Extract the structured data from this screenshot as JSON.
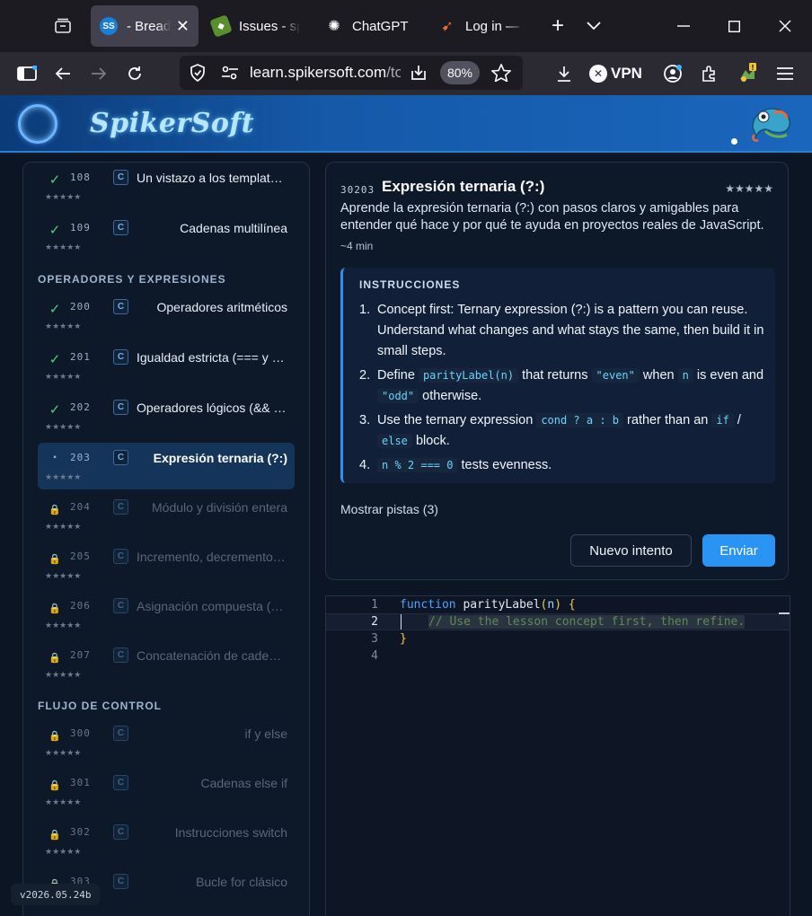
{
  "browser": {
    "tabs": [
      {
        "label": "- Breadt",
        "active": true
      },
      {
        "label": "Issues - spi",
        "active": false
      },
      {
        "label": "ChatGPT",
        "active": false
      },
      {
        "label": "Log in — S",
        "active": false
      }
    ],
    "url_host": "learn.spikersoft.com",
    "url_rest": "/to",
    "zoom": "80%",
    "vpn_label": "VPN",
    "icons": [
      "tab-list-icon",
      "new-tab-icon",
      "chevron-down-icon",
      "minimize-icon",
      "maximize-icon",
      "close-icon",
      "sidebar-icon",
      "back-icon",
      "forward-icon",
      "reload-icon",
      "shield-icon",
      "permissions-icon",
      "save-page-icon",
      "bookmark-star-icon",
      "download-icon",
      "vpn-icon",
      "account-icon",
      "extensions-icon",
      "notice-icon",
      "menu-icon"
    ]
  },
  "site": {
    "brand": "SpikerSoft"
  },
  "sidebar": {
    "sections": [
      "OPERADORES Y EXPRESIONES",
      "FLUJO DE CONTROL"
    ],
    "lessons": [
      {
        "num": "108",
        "title": "Un vistazo a los templates literales",
        "status": "done",
        "stars": "★★★★★"
      },
      {
        "num": "109",
        "title": "Cadenas multilínea",
        "status": "done",
        "stars": "★★★★★"
      },
      {
        "num": "200",
        "title": "Operadores aritméticos",
        "status": "done",
        "stars": "★★★★★"
      },
      {
        "num": "201",
        "title": "Igualdad estricta (=== y !==)",
        "status": "done",
        "stars": "★★★★★"
      },
      {
        "num": "202",
        "title": "Operadores lógicos (&& || !)",
        "status": "done",
        "stars": "★★★★★"
      },
      {
        "num": "203",
        "title": "Expresión ternaria (?:)",
        "status": "current",
        "stars": "★★★★★"
      },
      {
        "num": "204",
        "title": "Módulo y división entera",
        "status": "locked",
        "stars": "★★★★★"
      },
      {
        "num": "205",
        "title": "Incremento, decremento y más",
        "status": "locked",
        "stars": "★★★★★"
      },
      {
        "num": "206",
        "title": "Asignación compuesta (+=, -=)",
        "status": "locked",
        "stars": "★★★★★"
      },
      {
        "num": "207",
        "title": "Concatenación de cadenas",
        "status": "locked",
        "stars": "★★★★★"
      },
      {
        "num": "300",
        "title": "if y else",
        "status": "locked",
        "stars": "★★★★★"
      },
      {
        "num": "301",
        "title": "Cadenas else if",
        "status": "locked",
        "stars": "★★★★★"
      },
      {
        "num": "302",
        "title": "Instrucciones switch",
        "status": "locked",
        "stars": "★★★★★"
      },
      {
        "num": "303",
        "title": "Bucle for clásico",
        "status": "locked",
        "stars": "★★★★★"
      }
    ],
    "badge": "C",
    "version": "v2026.05.24b"
  },
  "lesson": {
    "id": "30203",
    "title": "Expresión ternaria (?:)",
    "stars": "★★★★★",
    "description": "Aprende la expresión ternaria (?:) con pasos claros y amigables para entender qué hace y por qué te ayuda en proyectos reales de JavaScript.",
    "time": "~4 min",
    "instructions_heading": "INSTRUCCIONES",
    "steps": {
      "s1": {
        "n": "1.",
        "text": "Concept first: Ternary expression (?:) is a pattern you can reuse. Understand what changes and what stays the same, then build it in small steps."
      },
      "s2": {
        "n": "2.",
        "a": "Define",
        "c1": "parityLabel(n)",
        "b": "that returns",
        "c2": "\"even\"",
        "d": "when",
        "c3": "n",
        "e": "is even and",
        "c4": "\"odd\"",
        "f": "otherwise."
      },
      "s3": {
        "n": "3.",
        "a": "Use the ternary expression",
        "c1": "cond ? a : b",
        "b": "rather than an",
        "c2": "if",
        "d": "/",
        "c3": "else",
        "e": "block."
      },
      "s4": {
        "n": "4.",
        "c1": "n % 2 === 0",
        "a": "tests evenness."
      }
    },
    "hints_label": "Mostrar pistas (3)",
    "retry_label": "Nuevo intento",
    "submit_label": "Enviar"
  },
  "editor": {
    "line_numbers": [
      "1",
      "2",
      "3",
      "4"
    ],
    "line1": {
      "kw": "function",
      "fn": " parityLabel",
      "p1": "(",
      "param": "n",
      "p2": ")",
      "sp": " ",
      "brace": "{"
    },
    "line2": {
      "comment": "// Use the lesson concept first, then refine."
    },
    "line3": {
      "brace": "}"
    }
  }
}
